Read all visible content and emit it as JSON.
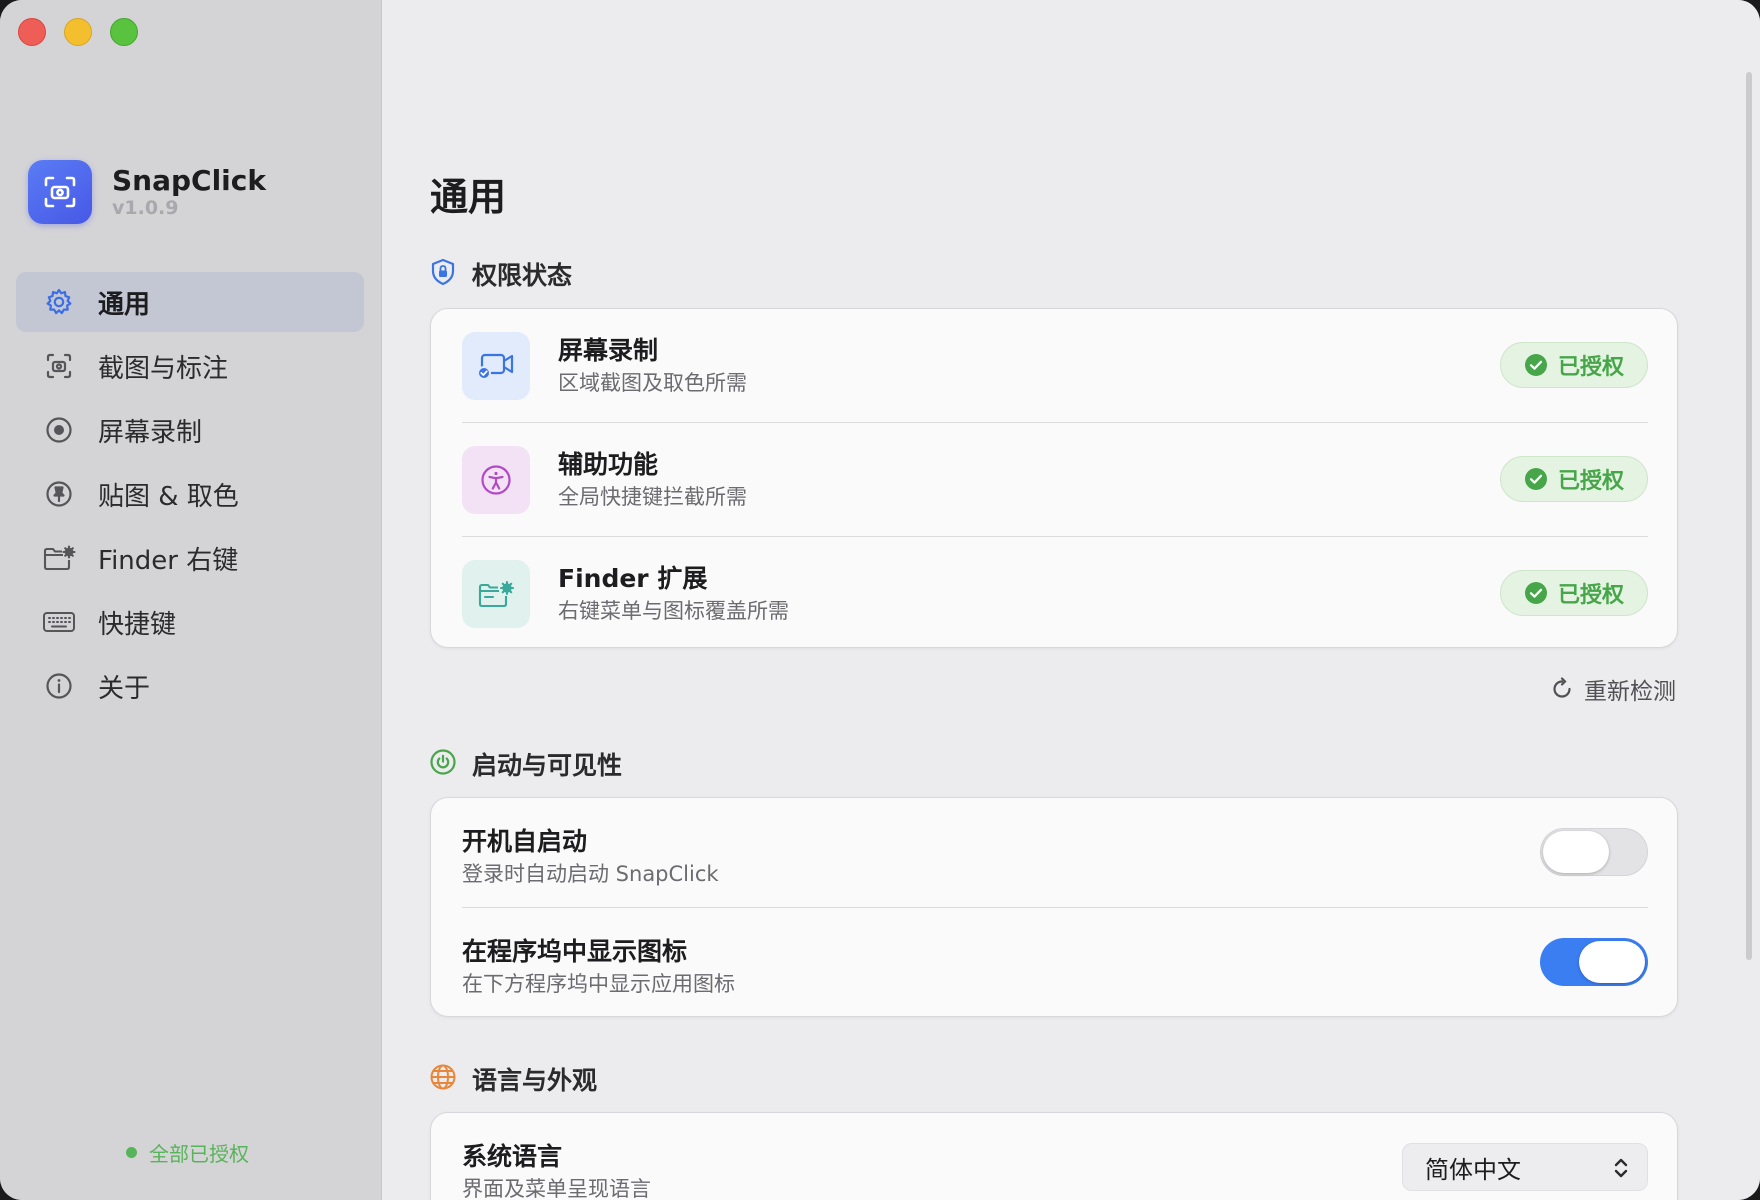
{
  "app": {
    "name": "SnapClick",
    "version": "v1.0.9"
  },
  "sidebar": {
    "items": [
      {
        "label": "通用",
        "icon": "gear-icon",
        "active": true
      },
      {
        "label": "截图与标注",
        "icon": "screenshot-icon",
        "active": false
      },
      {
        "label": "屏幕录制",
        "icon": "record-icon",
        "active": false
      },
      {
        "label": "贴图 & 取色",
        "icon": "pin-icon",
        "active": false
      },
      {
        "label": "Finder 右键",
        "icon": "folder-gear-icon",
        "active": false
      },
      {
        "label": "快捷键",
        "icon": "keyboard-icon",
        "active": false
      },
      {
        "label": "关于",
        "icon": "info-icon",
        "active": false
      }
    ],
    "footer_status": "全部已授权"
  },
  "main": {
    "title": "通用",
    "permissions": {
      "heading": "权限状态",
      "rows": [
        {
          "title": "屏幕录制",
          "subtitle": "区域截图及取色所需",
          "status": "已授权",
          "icon": "camera-record-icon"
        },
        {
          "title": "辅助功能",
          "subtitle": "全局快捷键拦截所需",
          "status": "已授权",
          "icon": "accessibility-icon"
        },
        {
          "title": "Finder 扩展",
          "subtitle": "右键菜单与图标覆盖所需",
          "status": "已授权",
          "icon": "folder-gear-icon"
        }
      ],
      "recheck_label": "重新检测"
    },
    "startup": {
      "heading": "启动与可见性",
      "rows": [
        {
          "title": "开机自启动",
          "subtitle": "登录时自动启动 SnapClick",
          "enabled": false
        },
        {
          "title": "在程序坞中显示图标",
          "subtitle": "在下方程序坞中显示应用图标",
          "enabled": true
        }
      ]
    },
    "language": {
      "heading": "语言与外观",
      "rows": [
        {
          "title": "系统语言",
          "subtitle": "界面及菜单呈现语言",
          "value": "简体中文"
        }
      ]
    }
  },
  "colors": {
    "accent": "#3b7ef2",
    "success": "#47a64a",
    "logo": "#4f68ec"
  }
}
